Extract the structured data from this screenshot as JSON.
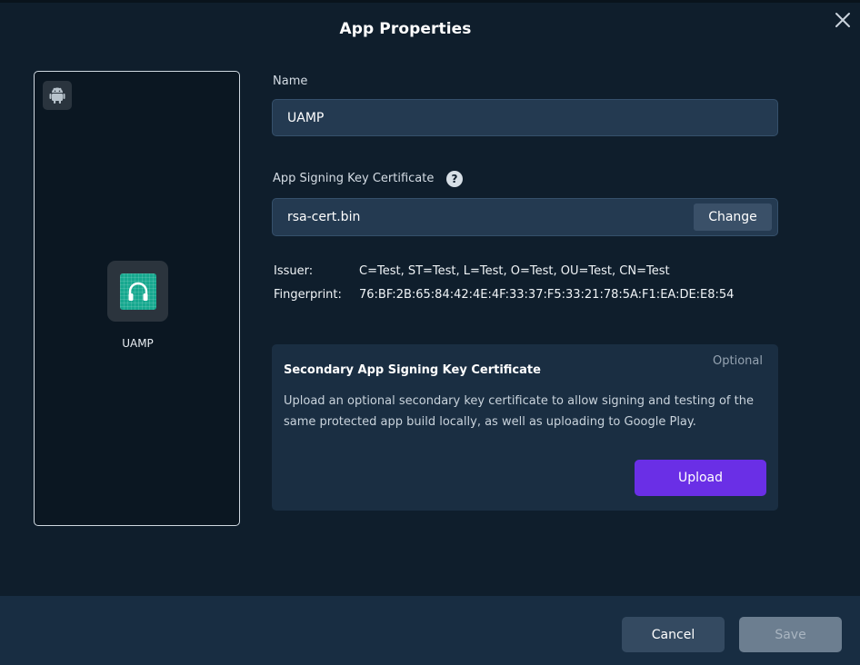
{
  "dialog": {
    "title": "App Properties",
    "close_icon": "close-icon"
  },
  "preview": {
    "platform_icon": "android-icon",
    "app_icon": "headphones-icon",
    "app_name": "UAMP"
  },
  "form": {
    "name_label": "Name",
    "name_value": "UAMP",
    "cert_label": "App Signing Key Certificate",
    "help_icon": "question-circle-icon",
    "help_glyph": "?",
    "cert_file": "rsa-cert.bin",
    "change_label": "Change",
    "issuer_key": "Issuer:",
    "issuer_value": "C=Test, ST=Test, L=Test, O=Test, OU=Test, CN=Test",
    "fingerprint_key": "Fingerprint:",
    "fingerprint_value": "76:BF:2B:65:84:42:4E:4F:33:37:F5:33:21:78:5A:F1:EA:DE:E8:54"
  },
  "secondary": {
    "optional_label": "Optional",
    "title": "Secondary App Signing Key Certificate",
    "description": "Upload an optional secondary key certificate to allow signing and testing of the same protected app build locally, as well as uploading to Google Play.",
    "upload_label": "Upload"
  },
  "footer": {
    "cancel_label": "Cancel",
    "save_label": "Save"
  },
  "colors": {
    "background": "#0f1e2c",
    "input_bg": "#243a51",
    "accent_purple": "#6a2fe6",
    "app_icon_green": "#17a88f",
    "footer_bg": "#182d42"
  }
}
